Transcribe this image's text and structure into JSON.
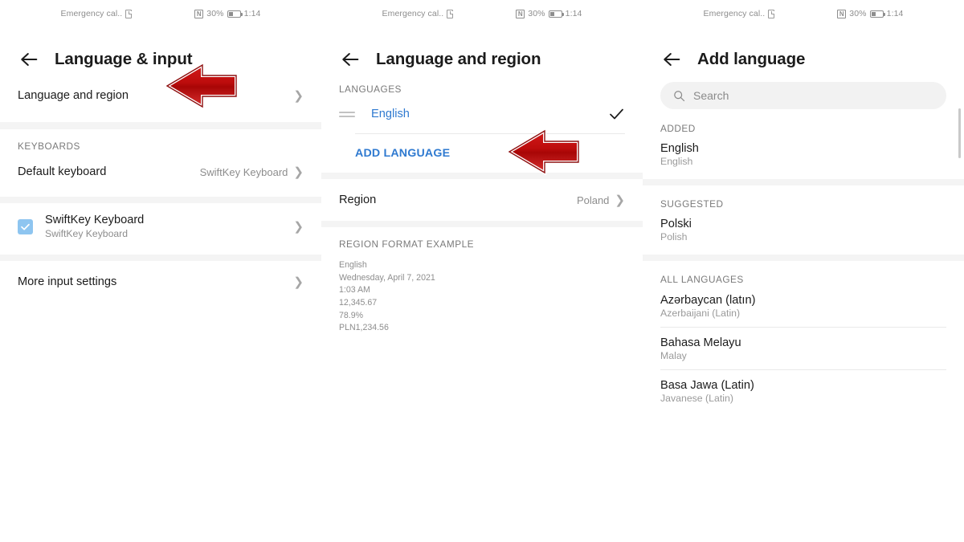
{
  "statusbar": {
    "carrier": "Emergency cal..",
    "sim_icon": "sim-card-icon",
    "signal_icon": "no-signal-icon",
    "battery_percent": "30%",
    "battery_icon": "battery-icon",
    "clock": "1:14"
  },
  "colors": {
    "link_blue": "#2f7ad0",
    "checkbox_blue": "#8ec5f0",
    "arrow_red": "#cc1111",
    "band_gray": "#f4f4f4"
  },
  "screen1": {
    "title": "Language & input",
    "back_icon": "back-arrow-icon",
    "rows": {
      "language_and_region": "Language and region",
      "keyboards_header": "KEYBOARDS",
      "default_keyboard_label": "Default keyboard",
      "default_keyboard_value": "SwiftKey Keyboard",
      "swiftkey_title": "SwiftKey Keyboard",
      "swiftkey_sub": "SwiftKey Keyboard",
      "more_input_settings": "More input settings"
    },
    "pointer": "red-left-arrow-pointing-at-language-and-region"
  },
  "screen2": {
    "title": "Language and region",
    "back_icon": "back-arrow-icon",
    "languages_header": "LANGUAGES",
    "language_item": "English",
    "add_language_label": "ADD LANGUAGE",
    "region_label": "Region",
    "region_value": "Poland",
    "format_header": "REGION FORMAT EXAMPLE",
    "format_lines": [
      "English",
      "Wednesday, April 7, 2021",
      "1:03 AM",
      "12,345.67",
      "78.9%",
      "PLN1,234.56"
    ],
    "pointer": "red-left-arrow-pointing-at-add-language"
  },
  "screen3": {
    "title": "Add language",
    "back_icon": "back-arrow-icon",
    "search_placeholder": "Search",
    "search_value": "",
    "search_icon": "search-icon",
    "added_header": "ADDED",
    "added": [
      {
        "native": "English",
        "english": "English"
      }
    ],
    "suggested_header": "SUGGESTED",
    "suggested": [
      {
        "native": "Polski",
        "english": "Polish"
      }
    ],
    "all_header": "ALL LANGUAGES",
    "all_languages": [
      {
        "native": "Azərbaycan (latın)",
        "english": "Azerbaijani (Latin)"
      },
      {
        "native": "Bahasa Melayu",
        "english": "Malay"
      },
      {
        "native": "Basa Jawa (Latin)",
        "english": "Javanese (Latin)"
      }
    ]
  }
}
